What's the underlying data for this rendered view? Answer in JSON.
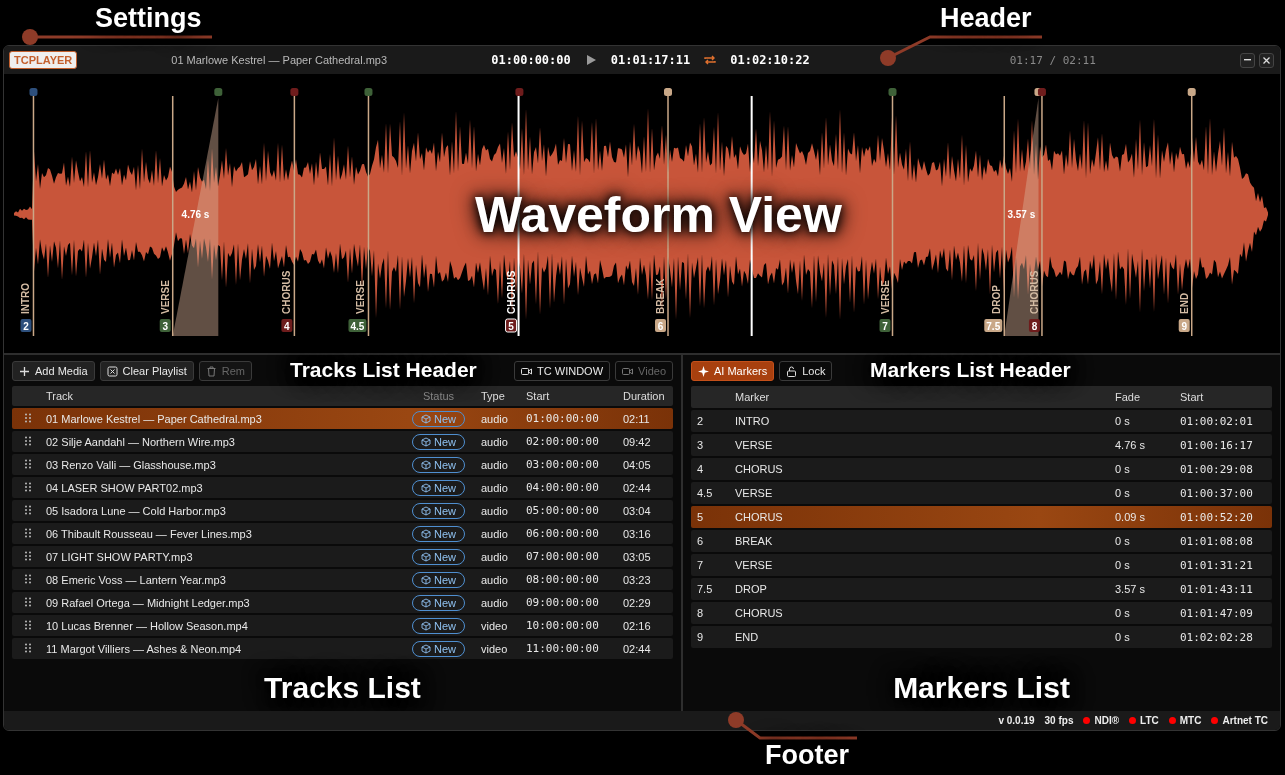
{
  "annotations": [
    {
      "kind": "callout",
      "text": "Settings"
    },
    {
      "kind": "callout",
      "text": "Header"
    },
    {
      "kind": "region",
      "text": "Waveform View"
    },
    {
      "kind": "heading",
      "text": "Tracks List Header"
    },
    {
      "kind": "heading",
      "text": "Markers List Header"
    },
    {
      "kind": "region",
      "text": "Tracks List"
    },
    {
      "kind": "region",
      "text": "Markers List"
    },
    {
      "kind": "callout",
      "text": "Footer"
    }
  ],
  "header": {
    "logo": "TCPLAYER",
    "track_title": "01 Marlowe Kestrel — Paper Cathedral.mp3",
    "timecode_start": "01:00:00:00",
    "timecode_current": "01:01:17:11",
    "timecode_end": "01:02:10:22",
    "loop_on": true,
    "position": "01:17 / 02:11"
  },
  "waveform": {
    "markers": [
      {
        "number": "2",
        "label": "INTRO",
        "color": "#2d4f7c",
        "selected": false
      },
      {
        "number": "3",
        "label": "VERSE",
        "color": "#3e6138",
        "selected": false,
        "fade_label": "4.76 s"
      },
      {
        "number": "4",
        "label": "CHORUS",
        "color": "#6e1c1c",
        "selected": false
      },
      {
        "number": "4.5",
        "label": "VERSE",
        "color": "#3e6138",
        "selected": false
      },
      {
        "number": "5",
        "label": "CHORUS",
        "color": "#6e1c1c",
        "selected": true
      },
      {
        "number": "6",
        "label": "BREAK",
        "color": "#c9a888",
        "selected": false
      },
      {
        "number": "7",
        "label": "VERSE",
        "color": "#3e6138",
        "selected": false
      },
      {
        "number": "7.5",
        "label": "DROP",
        "color": "#c9a888",
        "selected": false,
        "fade_label": "3.57 s"
      },
      {
        "number": "8",
        "label": "CHORUS",
        "color": "#6e1c1c",
        "selected": false
      },
      {
        "number": "9",
        "label": "END",
        "color": "#c9a888",
        "selected": false
      }
    ]
  },
  "tracks": {
    "toolbar": [
      {
        "kind": "add",
        "label": "Add Media",
        "disabled": false
      },
      {
        "kind": "clear",
        "label": "Clear Playlist",
        "disabled": false
      },
      {
        "kind": "remove",
        "label": "Rem",
        "disabled": true
      },
      {
        "kind": "window",
        "label": "TC WINDOW",
        "disabled": false
      },
      {
        "kind": "video",
        "label": "Video",
        "disabled": true
      }
    ],
    "columns": [
      "Track",
      "Status",
      "Type",
      "Start",
      "Duration"
    ],
    "rows": [
      {
        "title": "01 Marlowe Kestrel — Paper Cathedral.mp3",
        "status": "New",
        "type": "audio",
        "start": "01:00:00:00",
        "duration": "02:11",
        "selected": true
      },
      {
        "title": "02 Silje Aandahl — Northern Wire.mp3",
        "status": "New",
        "type": "audio",
        "start": "02:00:00:00",
        "duration": "09:42",
        "selected": false
      },
      {
        "title": "03 Renzo Valli — Glasshouse.mp3",
        "status": "New",
        "type": "audio",
        "start": "03:00:00:00",
        "duration": "04:05",
        "selected": false
      },
      {
        "title": "04 LASER SHOW PART02.mp3",
        "status": "New",
        "type": "audio",
        "start": "04:00:00:00",
        "duration": "02:44",
        "selected": false
      },
      {
        "title": "05 Isadora Lune — Cold Harbor.mp3",
        "status": "New",
        "type": "audio",
        "start": "05:00:00:00",
        "duration": "03:04",
        "selected": false
      },
      {
        "title": "06 Thibault Rousseau — Fever Lines.mp3",
        "status": "New",
        "type": "audio",
        "start": "06:00:00:00",
        "duration": "03:16",
        "selected": false
      },
      {
        "title": "07 LIGHT SHOW PARTY.mp3",
        "status": "New",
        "type": "audio",
        "start": "07:00:00:00",
        "duration": "03:05",
        "selected": false
      },
      {
        "title": "08 Emeric Voss — Lantern Year.mp3",
        "status": "New",
        "type": "audio",
        "start": "08:00:00:00",
        "duration": "03:23",
        "selected": false
      },
      {
        "title": "09 Rafael Ortega — Midnight Ledger.mp3",
        "status": "New",
        "type": "audio",
        "start": "09:00:00:00",
        "duration": "02:29",
        "selected": false
      },
      {
        "title": "10 Lucas Brenner — Hollow Season.mp4",
        "status": "New",
        "type": "video",
        "start": "10:00:00:00",
        "duration": "02:16",
        "selected": false
      },
      {
        "title": "11 Margot Villiers — Ashes & Neon.mp4",
        "status": "New",
        "type": "video",
        "start": "11:00:00:00",
        "duration": "02:44",
        "selected": false
      }
    ]
  },
  "markers_panel": {
    "toolbar": [
      {
        "kind": "ai",
        "label": "AI Markers",
        "active": true
      },
      {
        "kind": "lock",
        "label": "Lock",
        "active": false
      }
    ],
    "columns": [
      "Marker",
      "Fade",
      "Start"
    ],
    "rows": [
      {
        "number": "2",
        "name": "INTRO",
        "fade": "0 s",
        "start": "01:00:02:01",
        "selected": false
      },
      {
        "number": "3",
        "name": "VERSE",
        "fade": "4.76 s",
        "start": "01:00:16:17",
        "selected": false
      },
      {
        "number": "4",
        "name": "CHORUS",
        "fade": "0 s",
        "start": "01:00:29:08",
        "selected": false
      },
      {
        "number": "4.5",
        "name": "VERSE",
        "fade": "0 s",
        "start": "01:00:37:00",
        "selected": false
      },
      {
        "number": "5",
        "name": "CHORUS",
        "fade": "0.09 s",
        "start": "01:00:52:20",
        "selected": true
      },
      {
        "number": "6",
        "name": "BREAK",
        "fade": "0 s",
        "start": "01:01:08:08",
        "selected": false
      },
      {
        "number": "7",
        "name": "VERSE",
        "fade": "0 s",
        "start": "01:01:31:21",
        "selected": false
      },
      {
        "number": "7.5",
        "name": "DROP",
        "fade": "3.57 s",
        "start": "01:01:43:11",
        "selected": false
      },
      {
        "number": "8",
        "name": "CHORUS",
        "fade": "0 s",
        "start": "01:01:47:09",
        "selected": false
      },
      {
        "number": "9",
        "name": "END",
        "fade": "0 s",
        "start": "01:02:02:28",
        "selected": false
      }
    ]
  },
  "footer": {
    "version": "v 0.0.19",
    "fps": "30 fps",
    "outputs": [
      {
        "label": "NDI®",
        "color": "#ff0000"
      },
      {
        "label": "LTC",
        "color": "#ff0000"
      },
      {
        "label": "MTC",
        "color": "#ff0000"
      },
      {
        "label": "Artnet TC",
        "color": "#ff0000"
      }
    ]
  }
}
